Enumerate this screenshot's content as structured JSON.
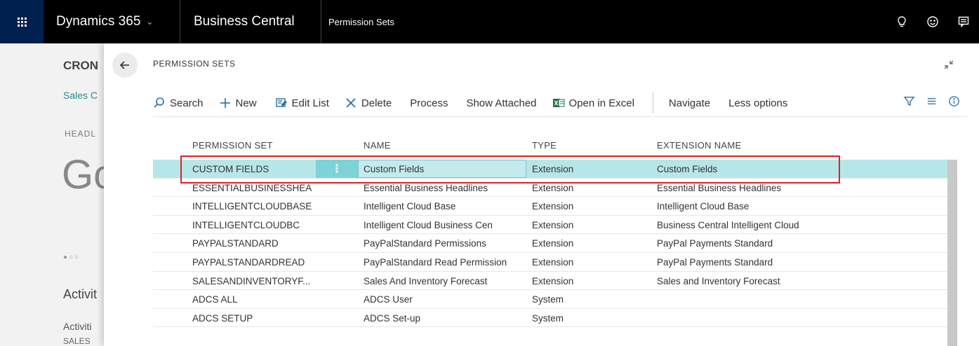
{
  "topbar": {
    "product": "Dynamics 365",
    "app": "Business Central",
    "page": "Permission Sets"
  },
  "background": {
    "company": "CRON",
    "link": "Sales C",
    "headline_label": "HEADL",
    "headline_big": "Go",
    "activities_title": "Activit",
    "activities_sub": "Activiti",
    "sales": "SALES"
  },
  "panel": {
    "title": "PERMISSION SETS"
  },
  "actions": {
    "search": "Search",
    "new": "New",
    "edit_list": "Edit List",
    "delete": "Delete",
    "process": "Process",
    "show_attached": "Show Attached",
    "open_in_excel": "Open in Excel",
    "navigate": "Navigate",
    "less_options": "Less options"
  },
  "table": {
    "columns": [
      "PERMISSION SET",
      "NAME",
      "TYPE",
      "EXTENSION NAME"
    ],
    "rows": [
      [
        "CUSTOM FIELDS",
        "Custom Fields",
        "Extension",
        "Custom Fields"
      ],
      [
        "ESSENTIALBUSINESSHEA",
        "Essential Business Headlines",
        "Extension",
        "Essential Business Headlines"
      ],
      [
        "INTELLIGENTCLOUDBASE",
        "Intelligent Cloud Base",
        "Extension",
        "Intelligent Cloud Base"
      ],
      [
        "INTELLIGENTCLOUDBC",
        "Intelligent Cloud Business Cen",
        "Extension",
        "Business Central Intelligent Cloud"
      ],
      [
        "PAYPALSTANDARD",
        "PayPalStandard Permissions",
        "Extension",
        "PayPal Payments Standard"
      ],
      [
        "PAYPALSTANDARDREAD",
        "PayPalStandard Read Permission",
        "Extension",
        "PayPal Payments Standard"
      ],
      [
        "SALESANDINVENTORYF...",
        "Sales And Inventory Forecast",
        "Extension",
        "Sales and Inventory Forecast"
      ],
      [
        "ADCS ALL",
        "ADCS User",
        "System",
        ""
      ],
      [
        "ADCS SETUP",
        "ADCS Set-up",
        "System",
        ""
      ]
    ],
    "row_menu": "⋮"
  },
  "colors": {
    "topbar": "#000000",
    "waffle": "#002050",
    "selected_row": "#b7e6e9",
    "highlight": "#e02020"
  }
}
